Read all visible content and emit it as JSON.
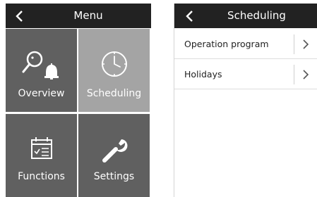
{
  "menu": {
    "title": "Menu",
    "tiles": [
      {
        "label": "Overview",
        "icon": "overview-icon"
      },
      {
        "label": "Scheduling",
        "icon": "clock-icon",
        "selected": true
      },
      {
        "label": "Functions",
        "icon": "calendar-icon"
      },
      {
        "label": "Settings",
        "icon": "wrench-icon"
      }
    ]
  },
  "scheduling": {
    "title": "Scheduling",
    "items": [
      {
        "label": "Operation program"
      },
      {
        "label": "Holidays"
      }
    ]
  },
  "colors": {
    "header": "#222222",
    "tile": "#606060",
    "tile_selected": "#a4a4a4"
  }
}
